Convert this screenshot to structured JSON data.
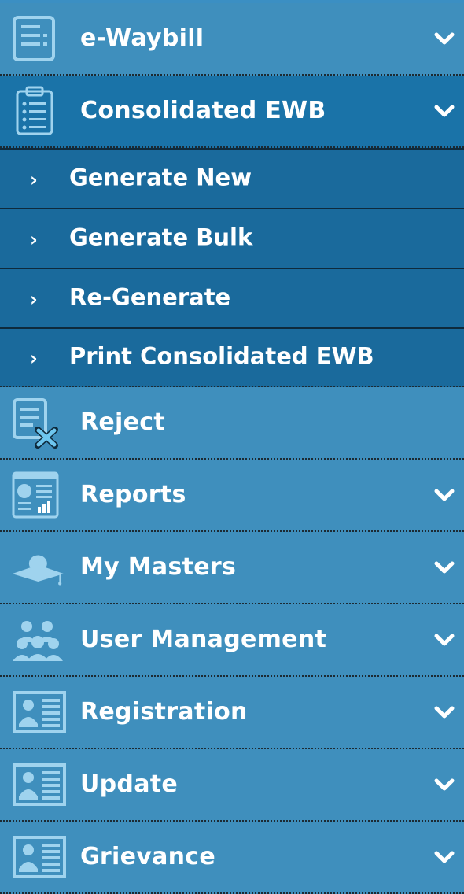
{
  "menu": {
    "ewaybill": {
      "label": "e-Waybill"
    },
    "consolidated": {
      "label": "Consolidated EWB",
      "subitems": [
        {
          "label": "Generate New"
        },
        {
          "label": "Generate Bulk"
        },
        {
          "label": "Re-Generate"
        },
        {
          "label": "Print Consolidated EWB"
        }
      ]
    },
    "reject": {
      "label": "Reject"
    },
    "reports": {
      "label": "Reports"
    },
    "masters": {
      "label": "My Masters"
    },
    "users": {
      "label": "User Management"
    },
    "registration": {
      "label": "Registration"
    },
    "update": {
      "label": "Update"
    },
    "grievance": {
      "label": "Grievance"
    }
  },
  "sub_arrow": "›",
  "colors": {
    "item_bg": "#3f8fbd",
    "expanded_bg": "#1a73a8",
    "subitem_bg": "#1a6a9c",
    "text": "#ffffff"
  }
}
